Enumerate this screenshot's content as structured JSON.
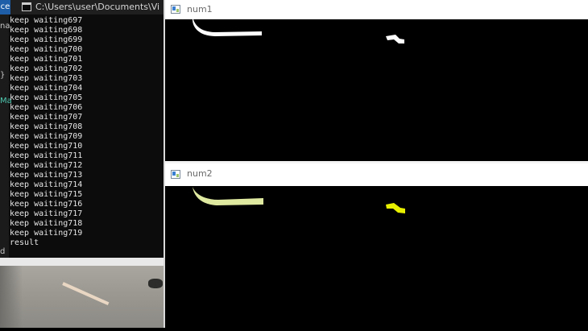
{
  "console": {
    "title": "C:\\Users\\user\\Documents\\Vi",
    "tab_fragment": "ce",
    "gutter_fragments": [
      "na",
      "}",
      "Ma",
      "d"
    ],
    "lines": [
      "keep waiting697",
      "keep waiting698",
      "keep waiting699",
      "keep waiting700",
      "keep waiting701",
      "keep waiting702",
      "keep waiting703",
      "keep waiting704",
      "keep waiting705",
      "keep waiting706",
      "keep waiting707",
      "keep waiting708",
      "keep waiting709",
      "keep waiting710",
      "keep waiting711",
      "keep waiting712",
      "keep waiting713",
      "keep waiting714",
      "keep waiting715",
      "keep waiting716",
      "keep waiting717",
      "keep waiting718",
      "keep waiting719",
      "result"
    ]
  },
  "windows": [
    {
      "id": "num1",
      "title": "num1",
      "stroke_color": "#ffffff"
    },
    {
      "id": "num2",
      "title": "num2",
      "stroke_color_main": "#dfeaa0",
      "stroke_color_blob": "#e8f000"
    }
  ]
}
